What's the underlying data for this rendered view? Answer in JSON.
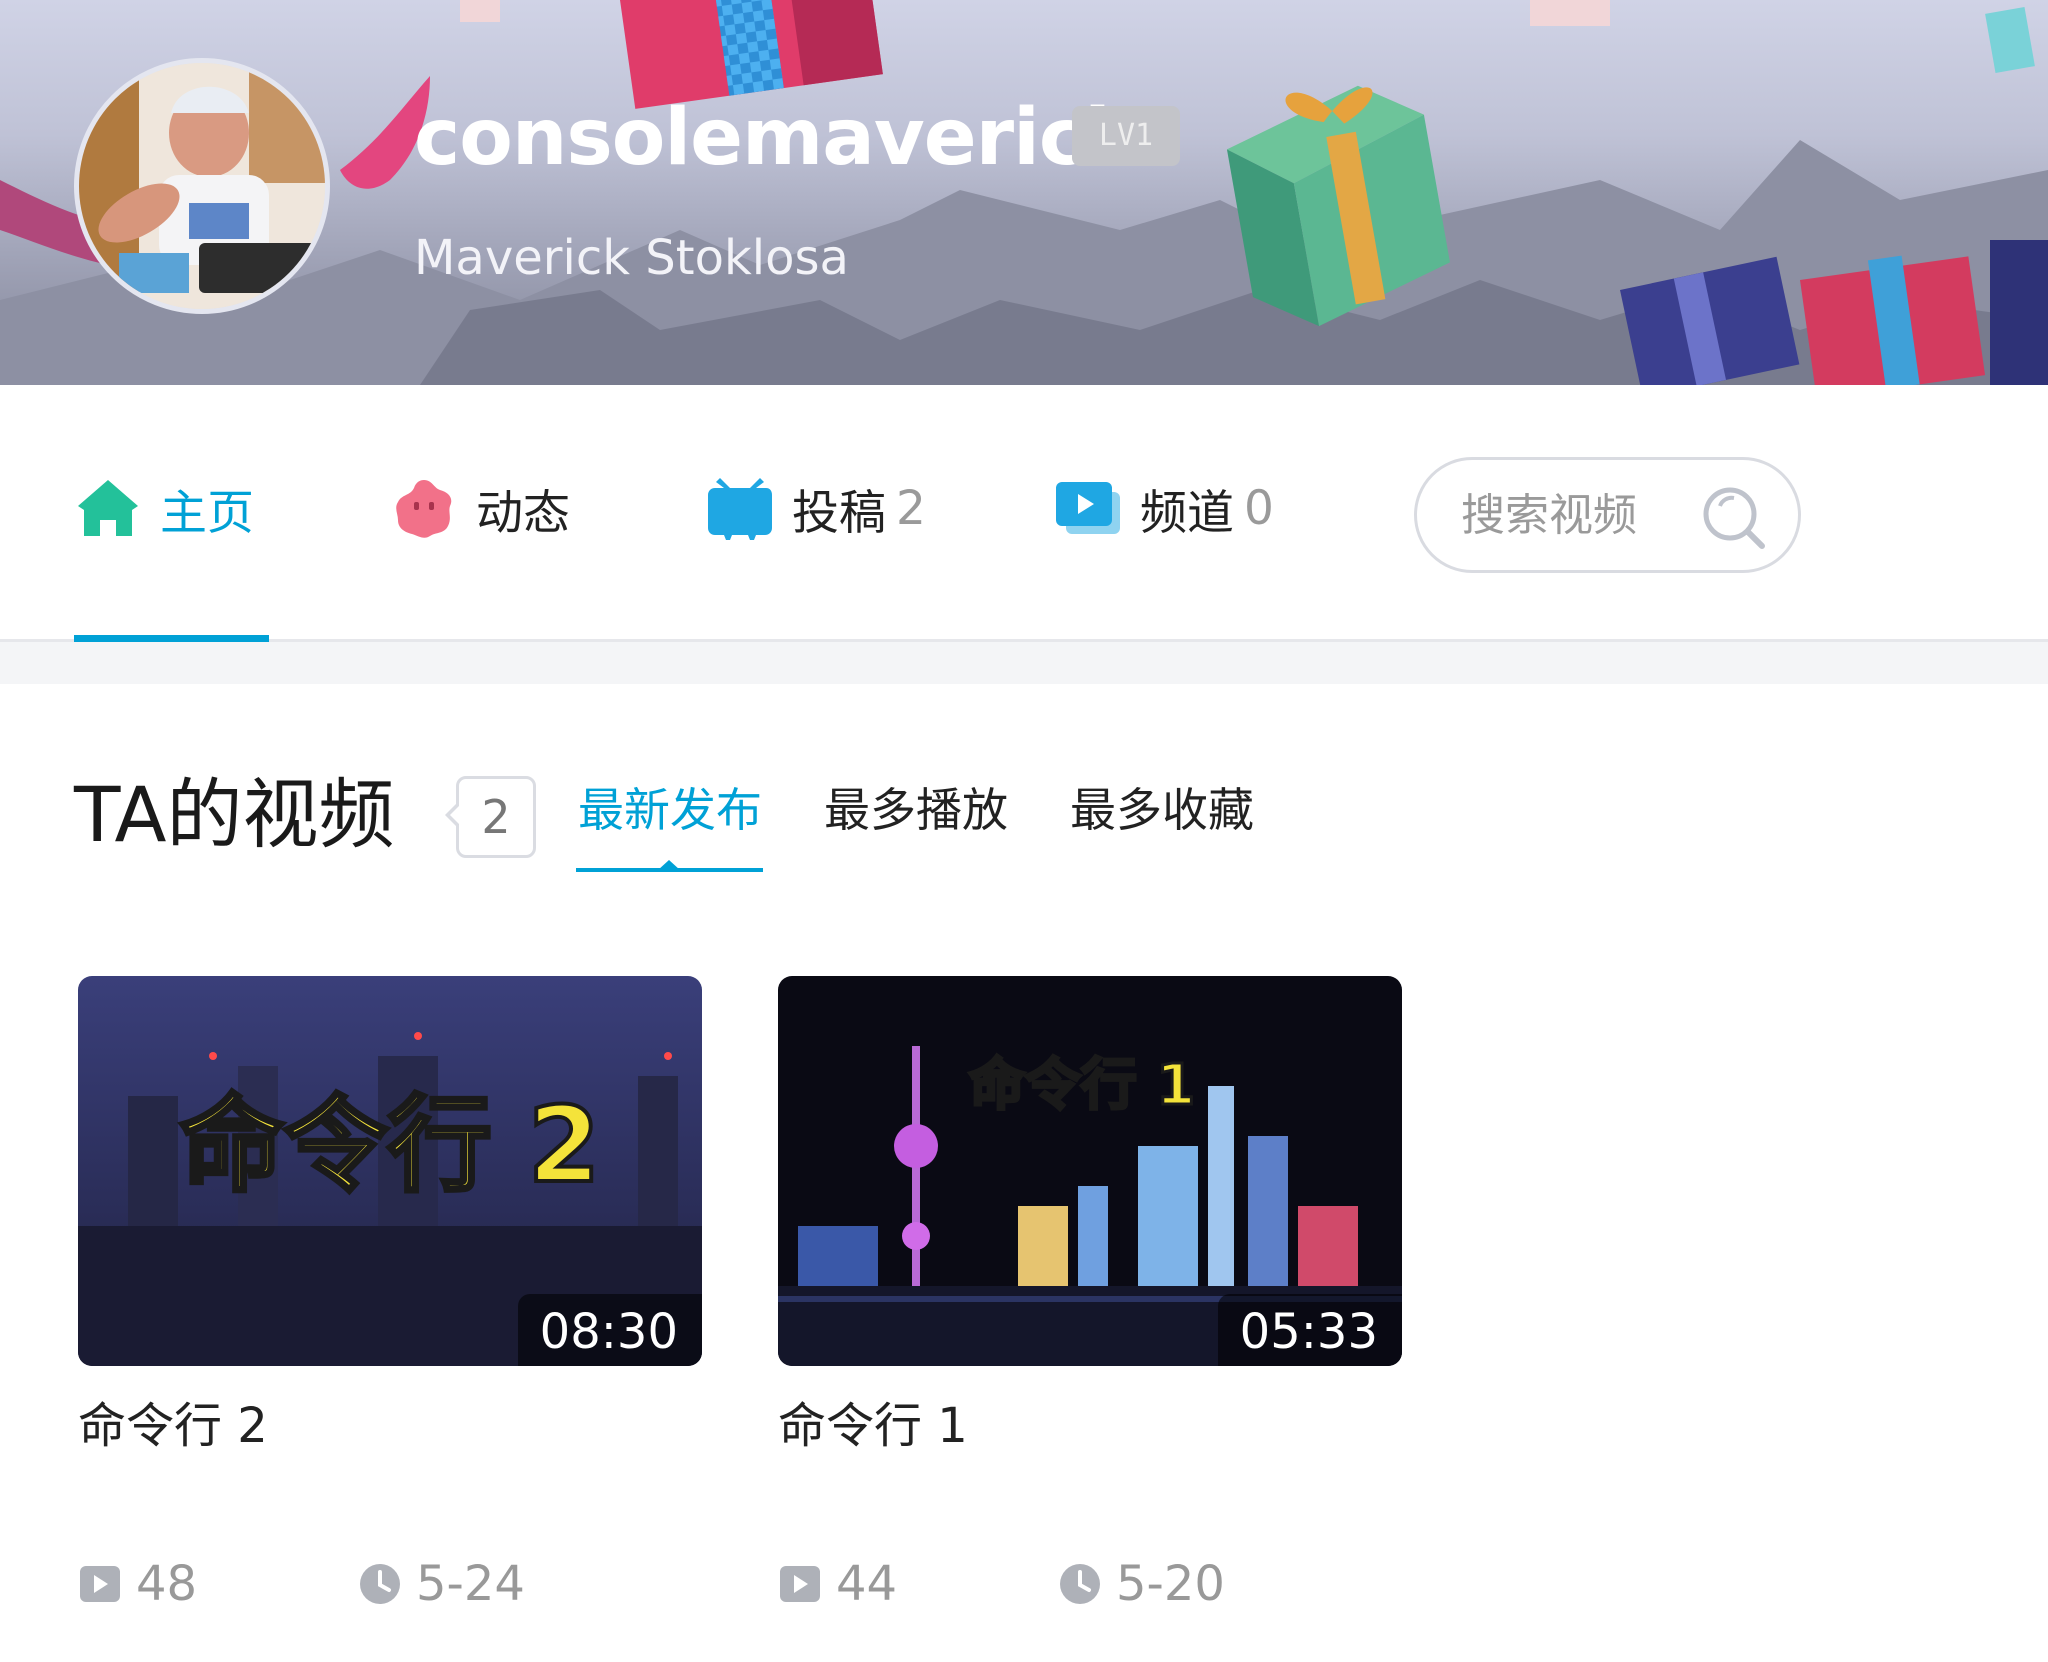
{
  "profile": {
    "username": "consolemaverick",
    "level": "LV1",
    "real_name": "Maverick Stoklosa",
    "avatar_icon": "user-avatar"
  },
  "nav": {
    "tabs": [
      {
        "label": "主页",
        "count": "",
        "icon": "home-icon",
        "active": true
      },
      {
        "label": "动态",
        "count": "",
        "icon": "dynamic-icon"
      },
      {
        "label": "投稿",
        "count": "2",
        "icon": "tv-icon"
      },
      {
        "label": "频道",
        "count": "0",
        "icon": "channel-icon"
      }
    ],
    "search_placeholder": "搜索视频",
    "accent_color": "#00a1d6"
  },
  "videos_section": {
    "title": "TA的视频",
    "count": "2",
    "sort_tabs": [
      "最新发布",
      "最多播放",
      "最多收藏"
    ],
    "active_sort": "最新发布"
  },
  "videos": [
    {
      "thumb_text": "命令行 2",
      "duration": "08:30",
      "title": "命令行 2",
      "plays": "48",
      "date": "5-24"
    },
    {
      "thumb_text": "命令行 1",
      "duration": "05:33",
      "title": "命令行 1",
      "plays": "44",
      "date": "5-20"
    }
  ]
}
